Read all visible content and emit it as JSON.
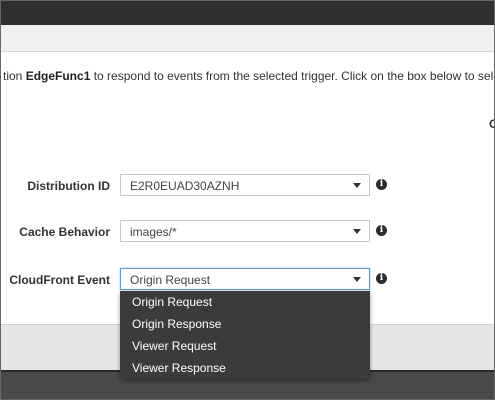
{
  "intro": {
    "prefix": "tion ",
    "function_name": "EdgeFunc1",
    "suffix": " to respond to events from the selected trigger. Click on the box below to select your tri",
    "cut_label": "C"
  },
  "form": {
    "distribution": {
      "label": "Distribution ID",
      "value": "E2R0EUAD30AZNH"
    },
    "cache": {
      "label": "Cache Behavior",
      "value": "images/*"
    },
    "event": {
      "label": "CloudFront Event",
      "value": "Origin Request"
    }
  },
  "dropdown": {
    "options": [
      "Origin Request",
      "Origin Response",
      "Viewer Request",
      "Viewer Response"
    ]
  },
  "icons": {
    "info": "i",
    "caret": "caret-down-icon"
  }
}
